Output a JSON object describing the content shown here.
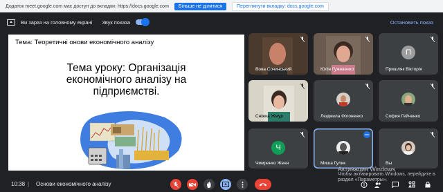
{
  "share_bar": {
    "message": "Додаток meet.google.com має доступ до вкладки: https://docs.google.com",
    "stop_label": "Більше не ділитися",
    "switch_label": "Переглянути вкладку: docs.google.com"
  },
  "present_bar": {
    "presenting_label": "Ви зараз на головному екрані",
    "audio_label": "Звук показа",
    "audio_on": true,
    "stop_label": "Остановить показ"
  },
  "slide": {
    "topic": "Тема: Теоретичні онови економічного аналізу",
    "lesson_lines": [
      "Тема уроку: Організація",
      "економічного аналізу на",
      "підприємстві."
    ]
  },
  "participants": [
    {
      "name": "Вова Сочинський",
      "type": "video",
      "muted": true
    },
    {
      "name": "Юлія Гужевенко",
      "type": "video",
      "muted": true
    },
    {
      "name": "Пришляк Вікторія",
      "type": "avatar",
      "initial": "П",
      "color": "#9e9e9e",
      "muted": true
    },
    {
      "name": "Сніжка Жмур",
      "type": "video",
      "muted": true
    },
    {
      "name": "Людмила Філоненко",
      "type": "photo",
      "muted": true
    },
    {
      "name": "София Гейченко",
      "type": "photo",
      "muted": true
    },
    {
      "name": "Чмиренко Женя",
      "type": "avatar",
      "initial": "Ч",
      "color": "#0f9d58",
      "muted": true
    },
    {
      "name": "Миша Гулик",
      "type": "photo",
      "muted": false
    },
    {
      "name": "Вы",
      "type": "photo",
      "muted": true
    }
  ],
  "watermark": {
    "line1": "Активация Windows",
    "line2": "Чтобы активировать Windows, перейдите в раздел «Параметры»."
  },
  "bottom_bar": {
    "time": "10:38",
    "separator": "|",
    "meeting_title": "Основи економічного аналізу"
  },
  "colors": {
    "accent": "#1a73e8",
    "danger": "#ea4335",
    "tile": "#3c4043",
    "bg": "#202124"
  }
}
